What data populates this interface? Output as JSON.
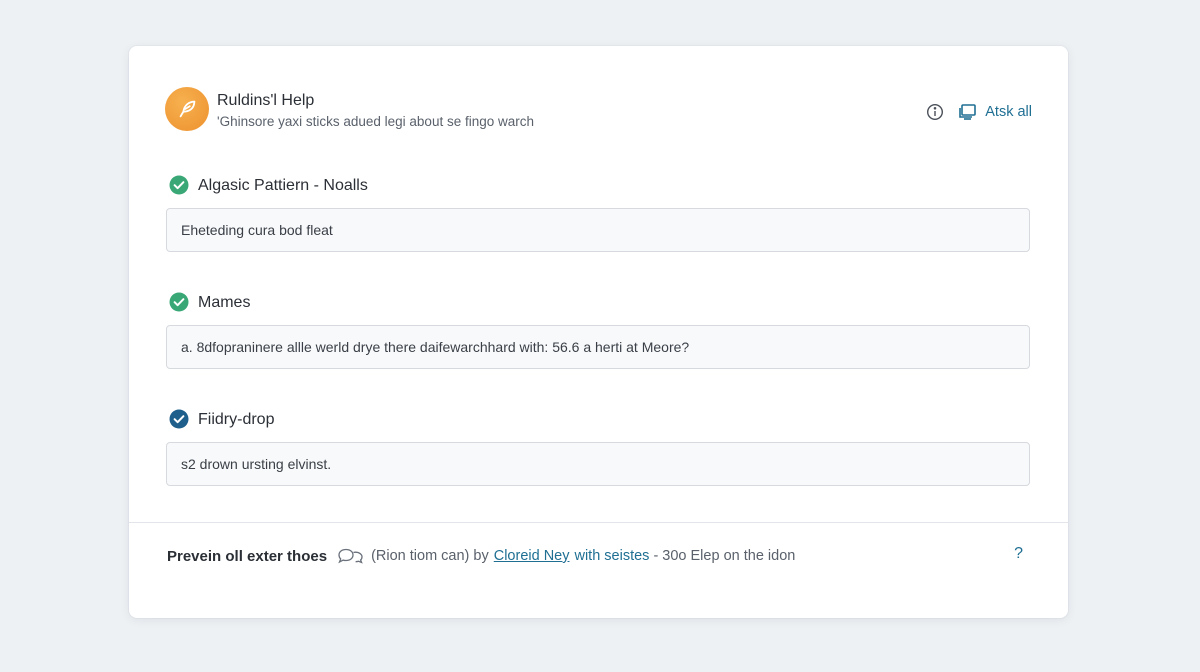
{
  "header": {
    "title": "Ruldins'l Help",
    "subtitle": "'Ghinsore yaxi sticks adued legi about se fingo warch",
    "ask_all_label": "Atsk all",
    "icons": [
      "feather-icon",
      "info-icon",
      "monitor-icon"
    ],
    "brand_color": "#f09a38",
    "accent_color": "#1f6f93"
  },
  "fields": [
    {
      "label": "Algasic Pattiern - Noalls",
      "value": "Eheteding cura bod fleat",
      "check_color": "#3aa876"
    },
    {
      "label": "Mames",
      "value": "a. 8dfopraninere allle werld drye there daifewarchhard with: 56.6 a herti at Meore?",
      "check_color": "#3aa876"
    },
    {
      "label": "Fiidry-drop",
      "value": "s2 drown ursting elvinst.",
      "check_color": "#1f5f8b"
    }
  ],
  "footer": {
    "lead": "Prevein oll exter thoes",
    "text": "(Rion tiom can) by",
    "link": "Cloreid Ney",
    "link_2": "with seistes",
    "tail": "- 30o Elep on the idon",
    "help": "?"
  }
}
